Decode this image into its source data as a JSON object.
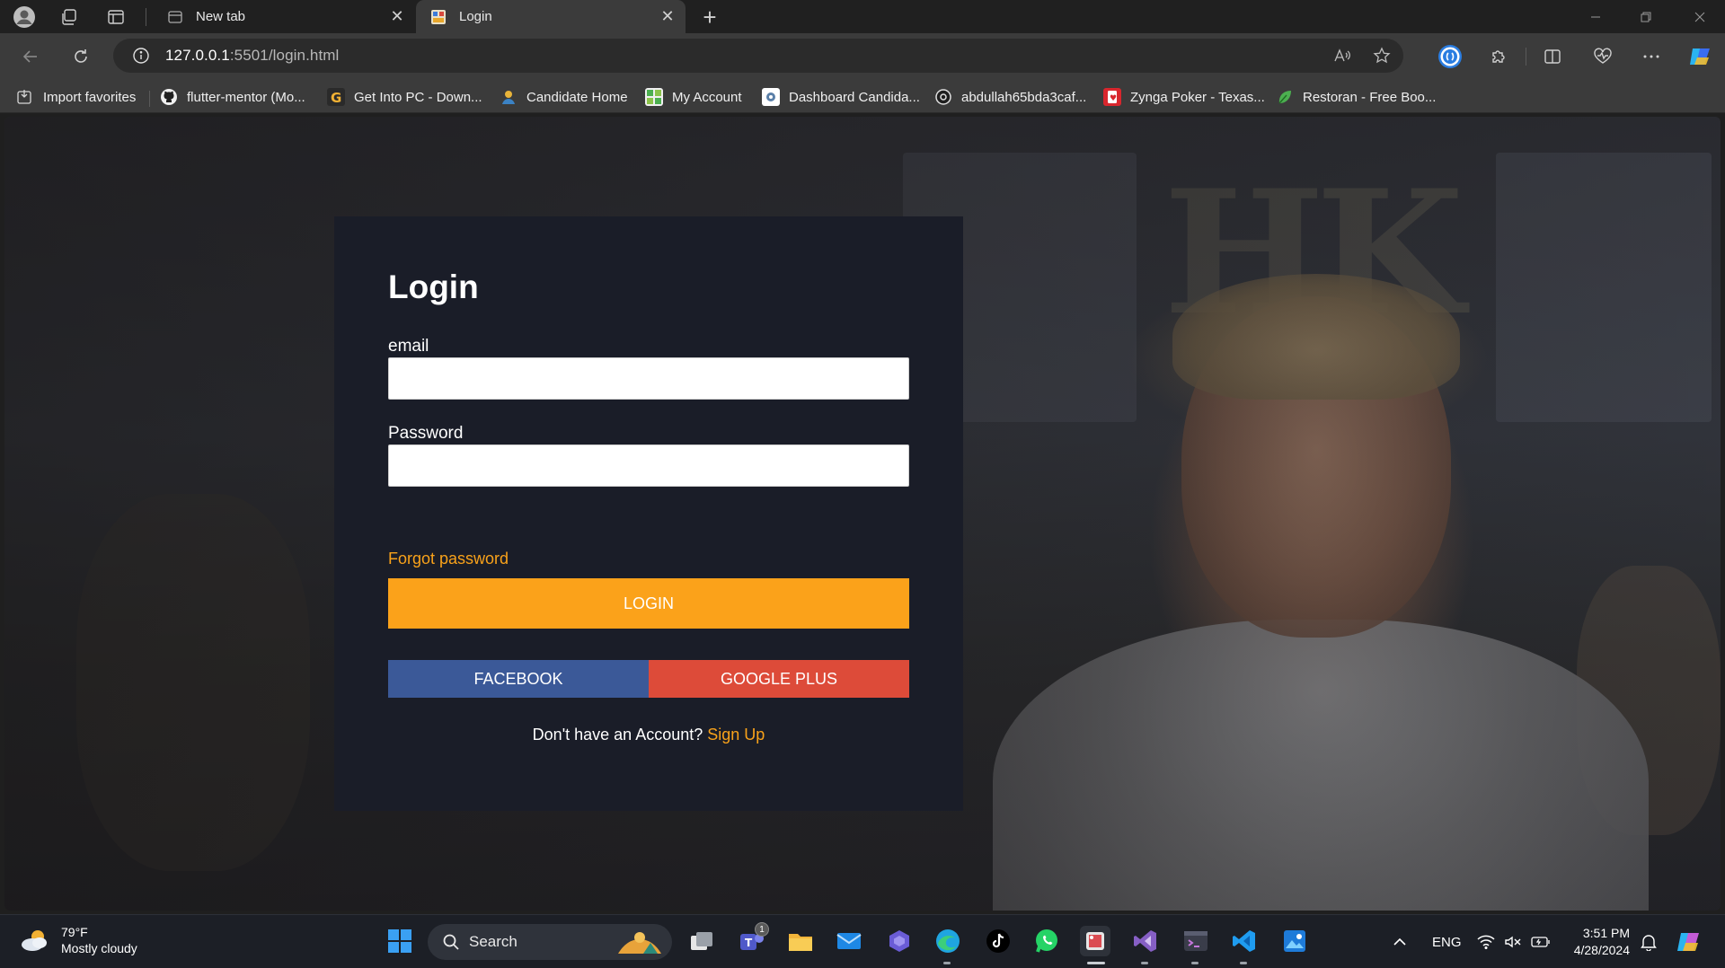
{
  "browser": {
    "tabs": [
      {
        "title": "New tab",
        "active": false
      },
      {
        "title": "Login",
        "active": true
      }
    ],
    "url_host": "127.0.0.1",
    "url_rest": ":5501/login.html",
    "favorites": [
      {
        "label": "Import favorites",
        "icon": "import-icon"
      },
      {
        "label": "flutter-mentor (Mo...",
        "icon": "github-icon"
      },
      {
        "label": "Get Into PC - Down...",
        "icon": "g-logo-icon"
      },
      {
        "label": "Candidate Home",
        "icon": "candidate-icon"
      },
      {
        "label": "My Account",
        "icon": "account-icon"
      },
      {
        "label": "Dashboard Candida...",
        "icon": "dashboard-icon"
      },
      {
        "label": "abdullah65bda3caf...",
        "icon": "chatgpt-icon"
      },
      {
        "label": "Zynga Poker - Texas...",
        "icon": "poker-icon"
      },
      {
        "label": "Restoran - Free Boo...",
        "icon": "leaf-icon"
      }
    ]
  },
  "login": {
    "title": "Login",
    "email_label": "email",
    "email_value": "",
    "password_label": "Password",
    "password_value": "",
    "forgot_link": "Forgot password",
    "login_button": "LOGIN",
    "facebook_button": "FACEBOOK",
    "google_button": "GOOGLE PLUS",
    "signup_prompt": "Don't have an Account?",
    "signup_link": "Sign Up"
  },
  "background": {
    "logo_text": "HK"
  },
  "taskbar": {
    "weather_temp": "79°F",
    "weather_desc": "Mostly cloudy",
    "search_label": "Search",
    "language": "ENG",
    "time": "3:51 PM",
    "date": "4/28/2024",
    "teams_badge": "1"
  },
  "colors": {
    "accent": "#fba21a",
    "facebook": "#3b5998",
    "google": "#dd4b39",
    "card_bg": "#1a1d28"
  }
}
